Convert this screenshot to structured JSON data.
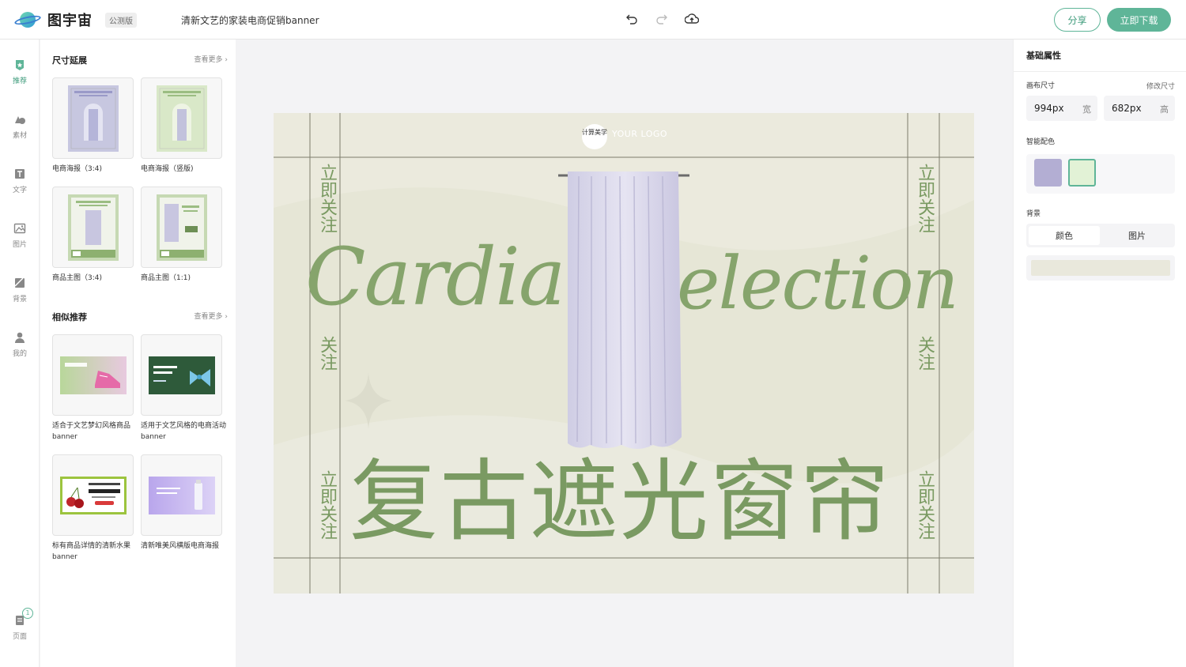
{
  "app": {
    "name": "图宇宙",
    "badge": "公测版",
    "doc_title": "清新文艺的家装电商促销banner",
    "share_label": "分享",
    "download_label": "立即下载"
  },
  "rail": [
    {
      "label": "推荐",
      "icon": "recommend-icon",
      "active": true
    },
    {
      "label": "素材",
      "icon": "material-icon"
    },
    {
      "label": "文字",
      "icon": "text-icon"
    },
    {
      "label": "图片",
      "icon": "image-icon"
    },
    {
      "label": "背景",
      "icon": "background-icon"
    },
    {
      "label": "我的",
      "icon": "user-icon"
    },
    {
      "label": "页面",
      "icon": "pages-icon",
      "badge": "1"
    }
  ],
  "left_panel": {
    "size_section": {
      "title": "尺寸延展",
      "more": "查看更多",
      "items": [
        {
          "caption": "电商海报（3:4)"
        },
        {
          "caption": "电商海报（竖版)"
        },
        {
          "caption": "商品主图（3:4)"
        },
        {
          "caption": "商品主图（1:1)"
        }
      ]
    },
    "similar_section": {
      "title": "相似推荐",
      "more": "查看更多",
      "items": [
        {
          "caption": "适合于文艺梦幻风格商品banner",
          "thumb_text": "小雨女鞋"
        },
        {
          "caption": "适用于文艺风格的电商活动banner",
          "thumb_text": "可爱蝴蝶结 百搭发饰"
        },
        {
          "caption": "标有商品详情的清新水果banner",
          "thumb_text": "早美车厘子"
        },
        {
          "caption": "清新唯美风横版电商海报",
          "thumb_text": ""
        }
      ]
    }
  },
  "banner": {
    "logo_mark": "计算美学",
    "logo_text": "YOUR LOGO",
    "script_text_left": "Cardia",
    "script_text_right": "election",
    "headline": "复古遮光窗帘",
    "side_follow": "立即关注",
    "side_short": "关注",
    "bg_color": "#e6e6d6",
    "text_color": "#7a9a62"
  },
  "right_panel": {
    "title": "基础属性",
    "canvas_size_label": "画布尺寸",
    "resize_link": "修改尺寸",
    "width_value": "994px",
    "width_unit": "宽",
    "height_value": "682px",
    "height_unit": "高",
    "smart_color_label": "智能配色",
    "swatches": [
      "#b3aed3",
      "#e2f2d6"
    ],
    "background_label": "背景",
    "tab_color": "颜色",
    "tab_image": "图片"
  }
}
